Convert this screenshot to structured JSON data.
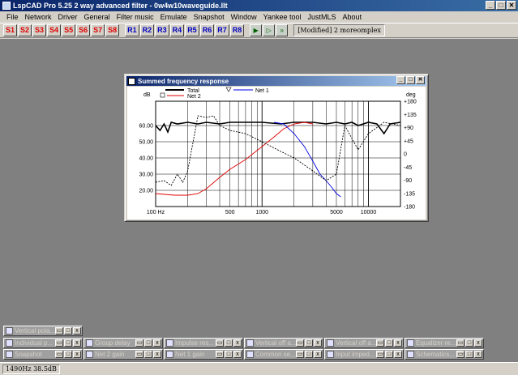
{
  "app": {
    "title": "LspCAD Pro 5.25 2 way advanced filter - 0w4w10waveguide.llt"
  },
  "window_buttons": {
    "minimize": "_",
    "maximize": "□",
    "close": "✕"
  },
  "menu": [
    "File",
    "Network",
    "Driver",
    "General",
    "Filter music",
    "Emulate",
    "Snapshot",
    "Window",
    "Yankee tool",
    "JustMLS",
    "About"
  ],
  "toolbar": {
    "s_buttons": [
      "S1",
      "S2",
      "S3",
      "S4",
      "S5",
      "S6",
      "S7",
      "S8"
    ],
    "r_buttons": [
      "R1",
      "R2",
      "R3",
      "R4",
      "R5",
      "R6",
      "R7",
      "R8"
    ],
    "icons": [
      "play-icon",
      "step-icon",
      "fast-icon"
    ],
    "status": "[Modified] 2 moreomplex"
  },
  "child_window": {
    "title": "Summed frequency response",
    "buttons": {
      "minimize": "_",
      "maximize": "□",
      "close": "✕"
    }
  },
  "chart_data": {
    "type": "line",
    "title": "",
    "xlabel": "",
    "ylabel": "dB",
    "y2label": "deg",
    "xscale": "log",
    "xlim": [
      100,
      20000
    ],
    "ylim": [
      10,
      75
    ],
    "y2lim": [
      -180,
      180
    ],
    "x_ticks": [
      {
        "value": 100,
        "label": "100 Hz"
      },
      {
        "value": 500,
        "label": "500"
      },
      {
        "value": 1000,
        "label": "1000"
      },
      {
        "value": 5000,
        "label": "5000"
      },
      {
        "value": 10000,
        "label": "10000"
      }
    ],
    "y_ticks": [
      {
        "value": 20,
        "label": "20.00"
      },
      {
        "value": 30,
        "label": "30.00"
      },
      {
        "value": 40,
        "label": "40.00"
      },
      {
        "value": 50,
        "label": "50.00"
      },
      {
        "value": 60,
        "label": "60.00"
      }
    ],
    "y2_ticks": [
      "+180",
      "+135",
      "+90",
      "+45",
      "0",
      "-45",
      "-90",
      "-135",
      "-180"
    ],
    "legend": [
      "Total",
      "Net 2",
      "Net 1"
    ],
    "grid": true,
    "series": [
      {
        "name": "Total",
        "color": "#000000",
        "style": "thick",
        "x": [
          100,
          110,
          120,
          130,
          140,
          160,
          200,
          250,
          300,
          400,
          500,
          700,
          1000,
          1500,
          2000,
          3000,
          4000,
          5000,
          6000,
          7000,
          8000,
          10000,
          12000,
          14000,
          16000,
          20000
        ],
        "y": [
          60,
          57,
          61,
          56,
          62,
          61,
          62,
          61,
          62,
          61,
          62,
          62,
          62,
          61,
          62,
          62,
          61,
          62,
          61,
          62,
          60,
          62,
          61,
          55,
          61,
          62
        ]
      },
      {
        "name": "Net 2",
        "color": "#e00000",
        "style": "solid",
        "x": [
          100,
          150,
          200,
          250,
          300,
          400,
          500,
          700,
          1000,
          1300,
          1600,
          2000,
          2500,
          3000
        ],
        "y": [
          18,
          17,
          17,
          18,
          21,
          28,
          33,
          39,
          47,
          53,
          58,
          61,
          62,
          61
        ]
      },
      {
        "name": "Net 1",
        "color": "#0000e0",
        "style": "solid",
        "x": [
          1300,
          1600,
          2000,
          2500,
          3000,
          3500,
          4000,
          4500,
          5000,
          5500
        ],
        "y": [
          62,
          61,
          55,
          47,
          38,
          30,
          26,
          22,
          18,
          16
        ]
      },
      {
        "name": "",
        "color": "#000000",
        "style": "dashed",
        "x": [
          100,
          120,
          140,
          160,
          180,
          200,
          250,
          300,
          350,
          400,
          500,
          700,
          1000,
          1500,
          2000,
          3000,
          4000,
          5000,
          6000,
          8000,
          10000,
          14000,
          20000
        ],
        "y": [
          25,
          26,
          23,
          30,
          25,
          32,
          66,
          65,
          66,
          60,
          57,
          55,
          50,
          44,
          40,
          32,
          26,
          30,
          60,
          45,
          55,
          62,
          60
        ]
      }
    ]
  },
  "minimized_windows": [
    {
      "label": "Vertical pola..."
    },
    {
      "label": "Individual p..."
    },
    {
      "label": "Group delay"
    },
    {
      "label": "Impulse res..."
    },
    {
      "label": "Vertical off a..."
    },
    {
      "label": "Vertical off a..."
    },
    {
      "label": "Equalizer re..."
    },
    {
      "label": "Snapshot"
    },
    {
      "label": "Net 2 gain"
    },
    {
      "label": "Net 1 gain"
    },
    {
      "label": "Common se..."
    },
    {
      "label": "Input imped..."
    },
    {
      "label": "Schematics..."
    }
  ],
  "statusbar": {
    "cursor": "1490Hz  38.5dB"
  }
}
